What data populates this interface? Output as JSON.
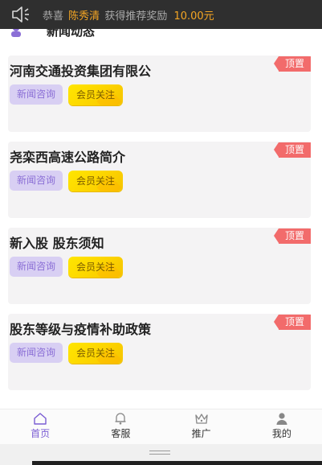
{
  "notice": {
    "icon": "speaker-icon",
    "prefix": "恭喜",
    "name": "陈秀清",
    "middle": "获得推荐奖励",
    "amount": "10.00元"
  },
  "section": {
    "icon": "news-icon",
    "title": "新闻动态"
  },
  "cards": [
    {
      "title": "河南交通投资集团有限公",
      "tag": "顶置",
      "news_label": "新闻咨询",
      "follow_label": "会员关注"
    },
    {
      "title": "尧栾西高速公路简介",
      "tag": "顶置",
      "news_label": "新闻咨询",
      "follow_label": "会员关注"
    },
    {
      "title": "新入股 股东须知",
      "tag": "顶置",
      "news_label": "新闻咨询",
      "follow_label": "会员关注"
    },
    {
      "title": "股东等级与疫情补助政策",
      "tag": "顶置",
      "news_label": "新闻咨询",
      "follow_label": "会员关注"
    }
  ],
  "tabbar": [
    {
      "label": "首页",
      "icon": "home-icon",
      "active": true
    },
    {
      "label": "客服",
      "icon": "bell-icon",
      "active": false
    },
    {
      "label": "推广",
      "icon": "crown-icon",
      "active": false
    },
    {
      "label": "我的",
      "icon": "user-icon",
      "active": false
    }
  ],
  "colors": {
    "accent": "#7a5cd3",
    "tag": "#f26b6b",
    "notice_bg": "#2f2f2f",
    "highlight": "#f5a623"
  }
}
